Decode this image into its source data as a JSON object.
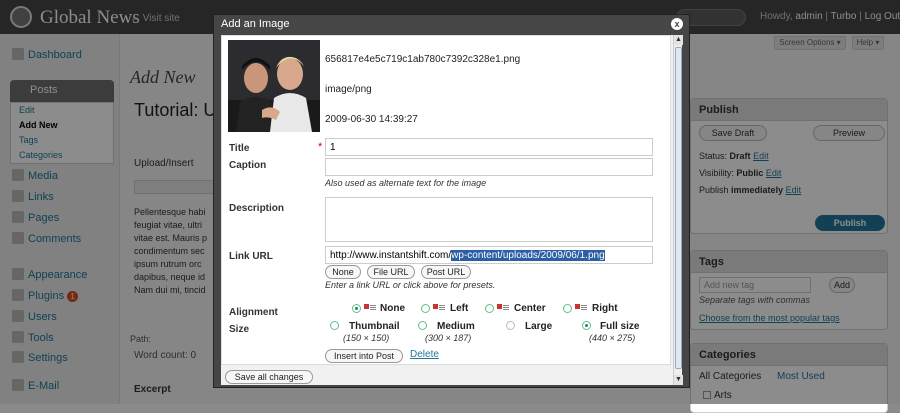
{
  "admin": {
    "site_title": "Global News",
    "visit_site": "← Visit site",
    "howdy_prefix": "Howdy,",
    "user": "admin",
    "sep": "|",
    "turbo": "Turbo",
    "logout": "Log Out",
    "screen_options": "Screen Options ▾",
    "help": "Help ▾",
    "menu": {
      "dashboard": "Dashboard",
      "posts": "Posts",
      "edit": "Edit",
      "add_new": "Add New",
      "tags": "Tags",
      "categories": "Categories",
      "media": "Media",
      "links": "Links",
      "pages": "Pages",
      "comments": "Comments",
      "appearance": "Appearance",
      "plugins": "Plugins",
      "plugins_count": "1",
      "users": "Users",
      "tools": "Tools",
      "settings": "Settings",
      "email": "E-Mail"
    },
    "page_heading": "Add New",
    "post_title": "Tutorial: U",
    "upload_insert": "Upload/Insert",
    "editor_text": "Pellentesque habi feugiat vitae, ultri vitae est. Mauris p condimentum sec ipsum rutrum orc dapibus, neque id Nam dui mi, tincid",
    "path_label": "Path:",
    "word_count": "Word count: 0",
    "excerpt": "Excerpt",
    "publish": {
      "header": "Publish",
      "save_draft": "Save Draft",
      "preview": "Preview",
      "status_label": "Status:",
      "status_value": "Draft",
      "visibility_label": "Visibility:",
      "visibility_value": "Public",
      "publish_label": "Publish",
      "publish_value": "immediately",
      "edit": "Edit",
      "publish_button": "Publish"
    },
    "tags": {
      "header": "Tags",
      "placeholder": "Add new tag",
      "add": "Add",
      "hint": "Separate tags with commas",
      "choose": "Choose from the most popular tags"
    },
    "categories": {
      "header": "Categories",
      "tab_all": "All Categories",
      "tab_used": "Most Used",
      "first": "Arts"
    }
  },
  "modal": {
    "title": "Add an Image",
    "close": "x",
    "file_name": "656817e4e5c719c1ab780c7392c328e1.png",
    "mime": "image/png",
    "date": "2009-06-30 14:39:27",
    "title_label": "Title",
    "required_mark": "*",
    "title_value": "1",
    "caption_label": "Caption",
    "caption_value": "",
    "caption_hint": "Also used as alternate text for the image",
    "description_label": "Description",
    "description_value": "",
    "link_label": "Link URL",
    "link_prefix": "http://www.instantshift.com/",
    "link_selected": "wp-content/uploads/2009/06/1.png",
    "btn_none": "None",
    "btn_file": "File URL",
    "btn_post": "Post URL",
    "link_hint": "Enter a link URL or click above for presets.",
    "alignment_label": "Alignment",
    "align_none": "None",
    "align_left": "Left",
    "align_center": "Center",
    "align_right": "Right",
    "size_label": "Size",
    "size_thumbnail": "Thumbnail",
    "size_thumbnail_dim": "(150 × 150)",
    "size_medium": "Medium",
    "size_medium_dim": "(300 × 187)",
    "size_large": "Large",
    "size_full": "Full size",
    "size_full_dim": "(440 × 275)",
    "insert": "Insert into Post",
    "delete": "Delete",
    "save_all": "Save all changes"
  }
}
